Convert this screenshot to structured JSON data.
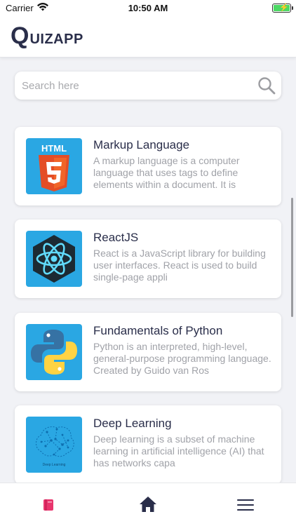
{
  "status_bar": {
    "carrier": "Carrier",
    "time": "10:50 AM"
  },
  "header": {
    "logo_initial": "Q",
    "logo_rest": "UIZAPP"
  },
  "search": {
    "placeholder": "Search here"
  },
  "topics": [
    {
      "title": "Markup Language",
      "description": "A markup language is a computer language that uses tags to define elements within a document. It is",
      "icon": "html5-logo-icon",
      "thumb_text": "HTML"
    },
    {
      "title": "ReactJS",
      "description": "React is a JavaScript library for building user interfaces. React is used to build single-page appli",
      "icon": "react-logo-icon"
    },
    {
      "title": "Fundamentals of Python",
      "description": "Python is an interpreted, high-level, general-purpose programming language. Created by Guido van Ros",
      "icon": "python-logo-icon"
    },
    {
      "title": "Deep Learning",
      "description": "Deep learning is a subset of machine learning in artificial intelligence (AI) that has networks capa",
      "icon": "brain-network-icon",
      "thumb_text": "Deep Learning"
    }
  ],
  "tabbar": {
    "items": [
      "book-icon",
      "home-icon",
      "menu-icon"
    ],
    "active_color": "#e8356d",
    "inactive_color": "#2a2e4a"
  },
  "colors": {
    "primary_text": "#2a2e4a",
    "thumb_bg": "#2aa7e3",
    "accent": "#e8356d"
  }
}
